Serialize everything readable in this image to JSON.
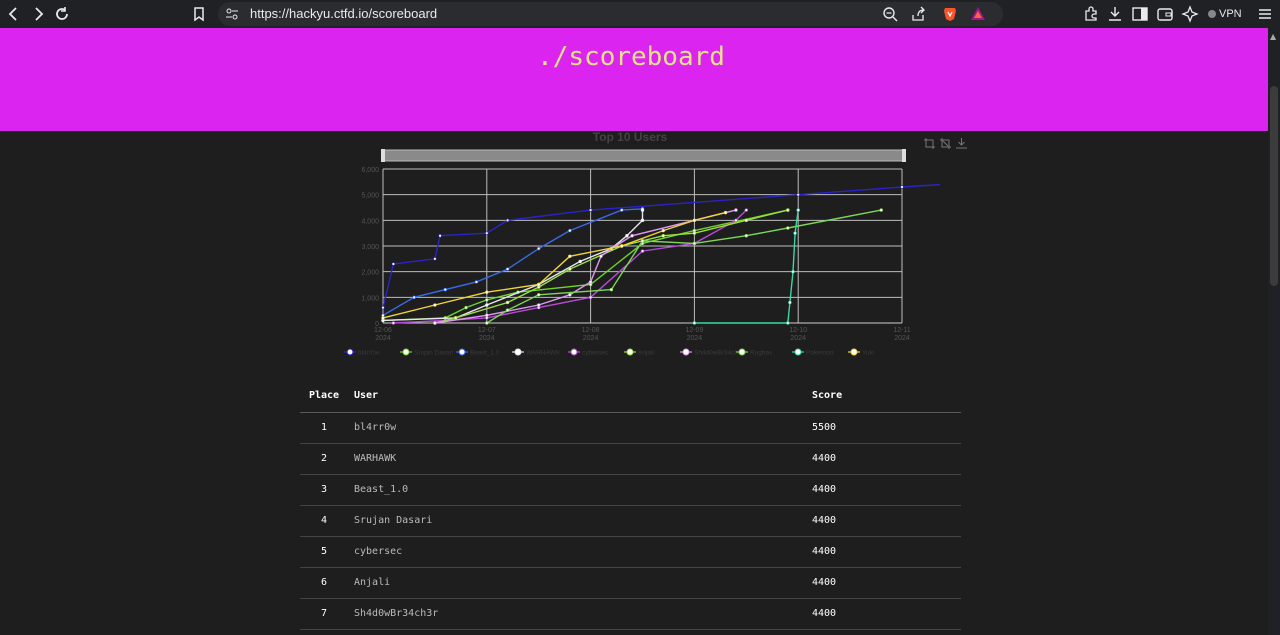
{
  "browser": {
    "url": "https://hackyu.ctfd.io/scoreboard",
    "vpn_label": "VPN",
    "icons": [
      "back-icon",
      "forward-icon",
      "reload-icon",
      "bookmark-icon",
      "site-info-icon",
      "zoom-icon",
      "share-icon",
      "brave-shields-icon",
      "brave-rewards-icon",
      "extensions-icon",
      "download-icon",
      "sidebar-icon",
      "wallet-icon",
      "leo-icon",
      "menu-icon"
    ]
  },
  "page": {
    "title": "./scoreboard",
    "hero_color": "#db24f0"
  },
  "chart_data": {
    "type": "line",
    "title": "Top 10 Users",
    "x_ticks": [
      "12-06\n2024",
      "12-07\n2024",
      "12-08\n2024",
      "12-09\n2024",
      "12-10\n2024",
      "12-11\n2024"
    ],
    "y_ticks": [
      0,
      1000,
      2000,
      3000,
      4000,
      5000,
      6000
    ],
    "ylim": [
      0,
      6000
    ],
    "grid": true,
    "legend_position": "bottom",
    "series": [
      {
        "name": "bl4rr0w",
        "color": "#2a24c8",
        "points": [
          [
            0.0,
            600
          ],
          [
            0.1,
            2300
          ],
          [
            0.5,
            2500
          ],
          [
            0.55,
            3400
          ],
          [
            1.0,
            3500
          ],
          [
            1.2,
            4000
          ],
          [
            2.0,
            4400
          ],
          [
            4.0,
            5000
          ],
          [
            5.0,
            5300
          ],
          [
            5.8,
            5500
          ]
        ]
      },
      {
        "name": "Srujan Dasari",
        "color": "#6fd42a",
        "points": [
          [
            0.0,
            100
          ],
          [
            0.6,
            200
          ],
          [
            0.8,
            600
          ],
          [
            1.0,
            900
          ],
          [
            1.3,
            1200
          ],
          [
            2.0,
            1500
          ],
          [
            2.5,
            3100
          ],
          [
            3.0,
            3600
          ],
          [
            3.9,
            4400
          ]
        ]
      },
      {
        "name": "Beast_1.0",
        "color": "#3a6ae8",
        "points": [
          [
            0.0,
            300
          ],
          [
            0.3,
            1000
          ],
          [
            0.6,
            1300
          ],
          [
            0.9,
            1600
          ],
          [
            1.2,
            2100
          ],
          [
            1.5,
            2900
          ],
          [
            1.8,
            3600
          ],
          [
            2.3,
            4400
          ],
          [
            2.5,
            4450
          ]
        ]
      },
      {
        "name": "WARHAWK",
        "color": "#e6e6f0",
        "points": [
          [
            0.0,
            100
          ],
          [
            0.7,
            200
          ],
          [
            1.0,
            700
          ],
          [
            1.5,
            1500
          ],
          [
            1.9,
            2400
          ],
          [
            2.2,
            2900
          ],
          [
            2.35,
            3400
          ],
          [
            2.5,
            4000
          ],
          [
            2.5,
            4400
          ]
        ]
      },
      {
        "name": "cybersec",
        "color": "#b84ad8",
        "points": [
          [
            0.1,
            0
          ],
          [
            0.6,
            100
          ],
          [
            1.0,
            200
          ],
          [
            1.5,
            600
          ],
          [
            2.0,
            1000
          ],
          [
            2.5,
            2800
          ],
          [
            3.0,
            3100
          ],
          [
            3.4,
            4000
          ],
          [
            3.5,
            4400
          ]
        ]
      },
      {
        "name": "Anjali",
        "color": "#9ae03a",
        "points": [
          [
            0.5,
            0
          ],
          [
            0.7,
            200
          ],
          [
            1.2,
            800
          ],
          [
            1.5,
            1400
          ],
          [
            1.8,
            2100
          ],
          [
            2.3,
            3000
          ],
          [
            2.7,
            3400
          ],
          [
            3.0,
            3500
          ],
          [
            3.5,
            4000
          ],
          [
            3.9,
            4400
          ]
        ]
      },
      {
        "name": "Sh4d0wBr34ch3r",
        "color": "#e098f0",
        "points": [
          [
            0.5,
            0
          ],
          [
            1.0,
            300
          ],
          [
            1.5,
            700
          ],
          [
            1.8,
            1100
          ],
          [
            2.0,
            1600
          ],
          [
            2.1,
            2600
          ],
          [
            2.2,
            2900
          ],
          [
            2.4,
            3400
          ],
          [
            3.4,
            4400
          ]
        ]
      },
      {
        "name": "Rughav",
        "color": "#7ad854",
        "points": [
          [
            1.0,
            0
          ],
          [
            1.2,
            500
          ],
          [
            1.5,
            1100
          ],
          [
            2.2,
            1300
          ],
          [
            2.5,
            3200
          ],
          [
            3.0,
            3100
          ],
          [
            3.5,
            3400
          ],
          [
            3.9,
            3700
          ],
          [
            4.8,
            4400
          ]
        ]
      },
      {
        "name": "Pokemon",
        "color": "#38d8a8",
        "points": [
          [
            3.0,
            0
          ],
          [
            3.9,
            0
          ],
          [
            3.92,
            800
          ],
          [
            3.95,
            2000
          ],
          [
            3.97,
            3500
          ],
          [
            4.0,
            4400
          ]
        ]
      },
      {
        "name": "Yuki",
        "color": "#f0d438",
        "points": [
          [
            0.0,
            200
          ],
          [
            0.5,
            700
          ],
          [
            1.0,
            1200
          ],
          [
            1.5,
            1500
          ],
          [
            1.8,
            2600
          ],
          [
            2.3,
            3000
          ],
          [
            2.7,
            3600
          ],
          [
            3.0,
            4000
          ],
          [
            3.3,
            4300
          ]
        ]
      }
    ]
  },
  "legend_labels": {
    "0": "bl4rr0w",
    "1": "Srujan Dasari",
    "2": "Beast_1.0",
    "3": "WARHAWK",
    "4": "cybersec",
    "5": "Anjali",
    "6": "Sh4d0wBr34ch3r",
    "7": "Rughav",
    "8": "Pokemon",
    "9": "Yuki"
  },
  "table": {
    "headers": {
      "place": "Place",
      "user": "User",
      "score": "Score"
    },
    "rows": [
      {
        "place": "1",
        "user": "bl4rr0w",
        "score": "5500"
      },
      {
        "place": "2",
        "user": "WARHAWK",
        "score": "4400"
      },
      {
        "place": "3",
        "user": "Beast_1.0",
        "score": "4400"
      },
      {
        "place": "4",
        "user": "Srujan Dasari",
        "score": "4400"
      },
      {
        "place": "5",
        "user": "cybersec",
        "score": "4400"
      },
      {
        "place": "6",
        "user": "Anjali",
        "score": "4400"
      },
      {
        "place": "7",
        "user": "Sh4d0wBr34ch3r",
        "score": "4400"
      }
    ]
  }
}
